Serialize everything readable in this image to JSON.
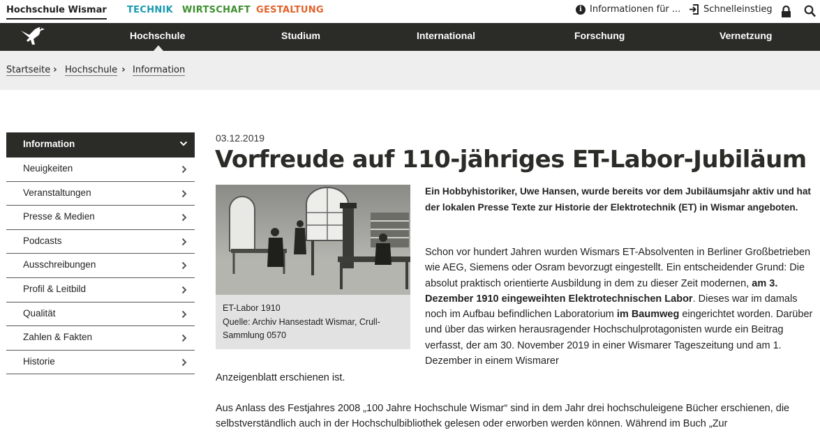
{
  "topbar": {
    "brand": "Hochschule Wismar",
    "faculties": [
      "TECHNIK",
      "WIRTSCHAFT",
      "GESTALTUNG"
    ],
    "info_label": "Informationen für ...",
    "quick_label": "Schnelleinstieg",
    "icons": {
      "info": "info-circle-icon",
      "quick": "entry-arrow-icon",
      "lock": "lock-icon",
      "search": "search-icon"
    }
  },
  "nav": {
    "items": [
      "Hochschule",
      "Studium",
      "International",
      "Forschung",
      "Vernetzung"
    ],
    "active": "Hochschule"
  },
  "breadcrumb": [
    "Startseite",
    "Hochschule",
    "Information"
  ],
  "sidebar": {
    "heading": "Information",
    "items": [
      "Neuigkeiten",
      "Veranstaltungen",
      "Presse & Medien",
      "Podcasts",
      "Ausschreibungen",
      "Profil & Leitbild",
      "Qualität",
      "Zahlen & Fakten",
      "Historie"
    ]
  },
  "article": {
    "date": "03.12.2019",
    "title": "Vorfreude auf 110-jähriges ET-Labor-Jubiläum",
    "caption_line1": "ET-Labor 1910",
    "caption_line2": "Quelle: Archiv Hansestadt Wismar, Crull-Sammlung 0570",
    "lead": "Ein Hobbyhistoriker, Uwe Hansen, wurde bereits vor dem Jubiläumsjahr aktiv und hat der lokalen Presse Texte zur Historie der Elektrotechnik (ET) in Wismar angeboten.",
    "p1_a": "Schon vor hundert Jahren wurden Wismars ET-Absolventen in Berliner Großbetrieben wie AEG, Siemens oder Osram bevorzugt eingestellt. Ein entscheidender Grund: Die absolut praktisch orientierte Ausbildung in dem zu dieser Zeit modernen, ",
    "p1_b": "am 3. Dezember 1910 eingeweihten Elektrotechnischen Labor",
    "p1_c": ". Dieses war im damals noch im Aufbau befindlichen Laboratorium ",
    "p1_d": "im Baumweg",
    "p1_e": " eingerichtet worden. Darüber und über das wirken herausragender Hochschulprotagonisten wurde ein Beitrag verfasst, der am 30. November 2019 in einer Wismarer Tageszeitung und am 1. Dezember in einem Wismarer",
    "p1_tail": "Anzeigenblatt erschienen ist.",
    "p2": "Aus Anlass des Festjahres 2008 „100 Jahre Hochschule Wismar“ sind in dem Jahr drei hochschuleigene Bücher erschienen, die selbstverständlich auch in der Hochschulbibliothek gelesen oder erworben werden können. Während im Buch „Zur"
  },
  "colors": {
    "dark": "#2b2c27",
    "technik": "#1a9ab0",
    "wirtschaft": "#3d8f2f",
    "gestaltung": "#e2622a",
    "breadcrumb_bg": "#eeeeee"
  }
}
